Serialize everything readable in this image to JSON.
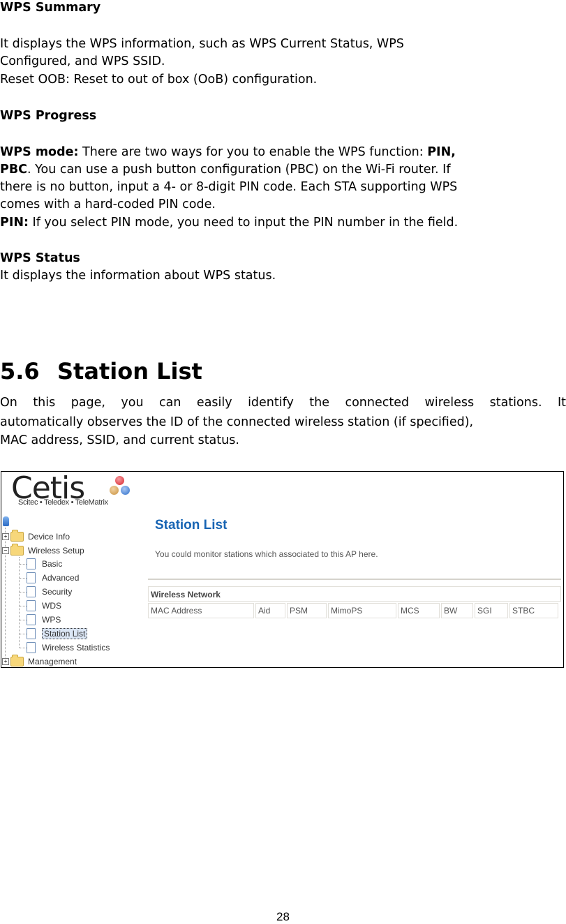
{
  "wps_summary": {
    "heading": "WPS Summary",
    "para_line1": "It displays the WPS information, such as WPS Current Status, WPS",
    "para_line2": "Configured, and WPS SSID.",
    "reset_line": "Reset OOB: Reset to out of box (OoB) configuration."
  },
  "wps_progress": {
    "heading": "WPS Progress",
    "mode_label": "WPS mode:",
    "mode_text1": " There are two ways for you to enable the WPS function: ",
    "mode_bold1": "PIN,",
    "mode_bold2": "PBC",
    "mode_text2": ". You can use a push button configuration (PBC) on the Wi-Fi router. If",
    "mode_text3": "there is no button, input a 4- or 8-digit PIN code. Each STA supporting WPS",
    "mode_text4": "comes with a hard-coded PIN code.",
    "pin_label": "PIN:",
    "pin_text": " If you select PIN mode, you need to input the PIN number in the field."
  },
  "wps_status": {
    "heading": "WPS Status",
    "text": "It displays the information about WPS status."
  },
  "section": {
    "number": "5.6",
    "title": "Station List",
    "para_line1": "On this page, you can easily identify the connected wireless stations. It",
    "para_line2": "automatically observes the ID of the connected wireless station (if specified),",
    "para_line3": "MAC address, SSID, and current status."
  },
  "screenshot": {
    "logo": {
      "word": "Cetis",
      "tagline": "Scitec • Teledex • TeleMatrix",
      "dot_colors": [
        "#d9252b",
        "#c8913f",
        "#2f6fc9"
      ]
    },
    "tree": {
      "items": [
        {
          "label": "Device Info",
          "type": "folder",
          "expander": "+"
        },
        {
          "label": "Wireless Setup",
          "type": "folder",
          "expander": "−"
        },
        {
          "label": "Basic",
          "type": "page"
        },
        {
          "label": "Advanced",
          "type": "page"
        },
        {
          "label": "Security",
          "type": "page"
        },
        {
          "label": "WDS",
          "type": "page"
        },
        {
          "label": "WPS",
          "type": "page"
        },
        {
          "label": "Station List",
          "type": "page",
          "selected": true
        },
        {
          "label": "Wireless Statistics",
          "type": "page"
        },
        {
          "label": "Management",
          "type": "folder",
          "expander": "+"
        }
      ]
    },
    "content": {
      "title": "Station List",
      "description": "You could monitor stations which associated to this AP here.",
      "title_color": "#1764b3",
      "table": {
        "section_header": "Wireless Network",
        "columns": [
          "MAC Address",
          "Aid",
          "PSM",
          "MimoPS",
          "MCS",
          "BW",
          "SGI",
          "STBC"
        ]
      }
    }
  },
  "page_number": "28"
}
